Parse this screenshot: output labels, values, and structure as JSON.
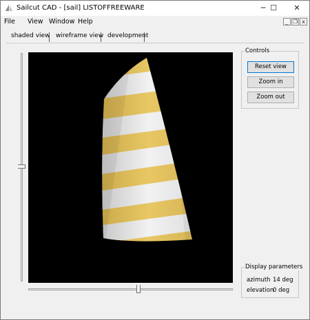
{
  "window": {
    "title": "Sailcut CAD - [sail]  LISTOFFREEWARE",
    "minimize_glyph": "─",
    "maximize_glyph": "☐",
    "close_glyph": "✕"
  },
  "menu": {
    "items": [
      "File",
      "View",
      "Window",
      "Help"
    ],
    "mdi_minimize": "_",
    "mdi_restore": "❐",
    "mdi_close": "x"
  },
  "tabs": [
    {
      "label": "shaded view",
      "active": true
    },
    {
      "label": "wireframe view",
      "active": false
    },
    {
      "label": "development",
      "active": false
    }
  ],
  "controls": {
    "title": "Controls",
    "reset_label": "Reset view",
    "zoom_in_label": "Zoom in",
    "zoom_out_label": "Zoom out"
  },
  "display_params": {
    "title": "Display parameters",
    "azimuth_label": "azimuth",
    "azimuth_value": "14 deg",
    "elevation_label": "elevation",
    "elevation_value": "0 deg"
  },
  "colors": {
    "viewport_bg": "#000000",
    "sail_gold": "#e6c25a",
    "sail_white": "#f4f4f0",
    "focus_border": "#0078d7"
  },
  "icons": {
    "app": "sail-icon"
  }
}
